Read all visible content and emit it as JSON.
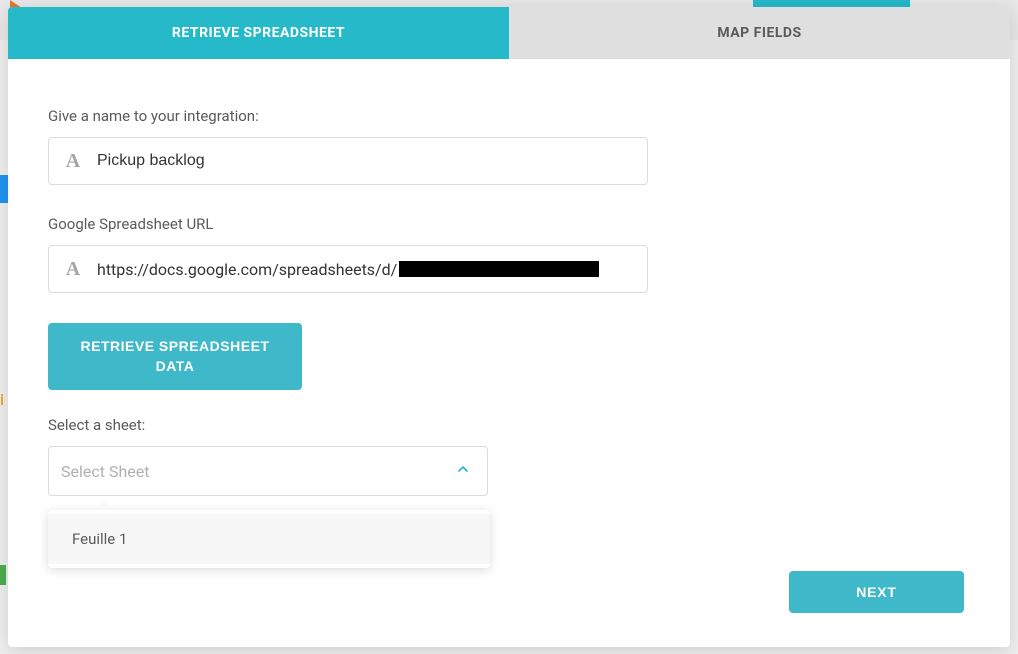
{
  "tabs": {
    "retrieve": "RETRIEVE SPREADSHEET",
    "map": "MAP FIELDS"
  },
  "fields": {
    "name_label": "Give a name to your integration:",
    "name_value": "Pickup backlog",
    "url_label": "Google Spreadsheet URL",
    "url_value": "https://docs.google.com/spreadsheets/d/",
    "sheet_label": "Select a sheet:",
    "sheet_placeholder": "Select Sheet"
  },
  "buttons": {
    "retrieve": "RETRIEVE SPREADSHEET DATA",
    "next": "NEXT"
  },
  "dropdown": {
    "options": [
      "Feuille 1"
    ]
  }
}
